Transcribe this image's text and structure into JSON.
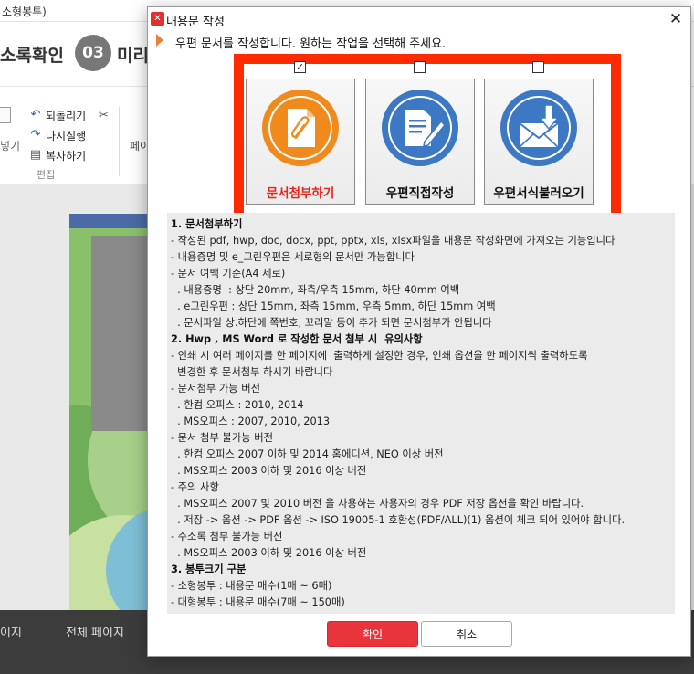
{
  "background": {
    "title": "소형봉투)",
    "step_prev_label": "소록확인",
    "step_number": "03",
    "step_current_label": "미리",
    "ribbon": {
      "paste_label": "넣기",
      "undo_label": "되돌리기",
      "redo_label": "다시실행",
      "copy_label": "복사하기",
      "group_label": "편집",
      "page_label": "페이"
    },
    "bottom_left": "이지",
    "bottom_total": "전체 페이지"
  },
  "dialog": {
    "title": "내용문 작성",
    "instruction": "우편 문서를 작성합니다. 원하는 작업을 선택해 주세요.",
    "options": [
      {
        "label": "문서첨부하기",
        "checked": true,
        "icon": "paperclip-document-icon",
        "color": "#f08a1c"
      },
      {
        "label": "우편직접작성",
        "checked": false,
        "icon": "document-pen-icon",
        "color": "#3d78c4"
      },
      {
        "label": "우편서식불러오기",
        "checked": false,
        "icon": "envelope-download-icon",
        "color": "#3d78c4"
      }
    ],
    "info": [
      {
        "text": "1. 문서첨부하기",
        "h": true
      },
      {
        "text": "- 작성된 pdf, hwp, doc, docx, ppt, pptx, xls, xlsx파일을 내용문 작성화면에 가져오는 기능입니다"
      },
      {
        "text": "- 내용증명 및 e_그린우편은 세로형의 문서만 가능합니다"
      },
      {
        "text": "- 문서 여백 기준(A4 세로)"
      },
      {
        "text": "  . 내용증명  : 상단 20mm, 좌측/우측 15mm, 하단 40mm 여백"
      },
      {
        "text": "  . e그린우편 : 상단 15mm, 좌측 15mm, 우측 5mm, 하단 15mm 여백"
      },
      {
        "text": "  . 문서파일 상.하단에 쪽번호, 꼬리말 등이 추가 되면 문서첨부가 안됩니다"
      },
      {
        "text": "2. Hwp , MS Word 로 작성한 문서 첨부 시  유의사항",
        "h": true
      },
      {
        "text": "- 인쇄 시 여러 페이지를 한 페이지에  출력하게 설정한 경우, 인쇄 옵션을 한 페이지씩 출력하도록"
      },
      {
        "text": "  변경한 후 문서첨부 하시기 바랍니다"
      },
      {
        "text": "- 문서첨부 가능 버전"
      },
      {
        "text": "  . 한컴 오피스 : 2010, 2014"
      },
      {
        "text": "  . MS오피스 : 2007, 2010, 2013"
      },
      {
        "text": "- 문서 첨부 불가능 버전"
      },
      {
        "text": "  . 한컴 오피스 2007 이하 및 2014 홈에디션, NEO 이상 버전"
      },
      {
        "text": "  . MS오피스 2003 이하 및 2016 이상 버전"
      },
      {
        "text": "- 주의 사항"
      },
      {
        "text": "  . MS오피스 2007 및 2010 버전 을 사용하는 사용자의 경우 PDF 저장 옵션을 확인 바랍니다."
      },
      {
        "text": "  . 저장 -> 옵션 -> PDF 옵션 -> ISO 19005-1 호환성(PDF/ALL)(1) 옵션이 체크 되어 있어야 합니다."
      },
      {
        "text": "- 주소록 첨부 불가능 버전"
      },
      {
        "text": "  . MS오피스 2003 이하 및 2016 이상 버전"
      },
      {
        "text": "3. 봉투크기 구분",
        "h": true
      },
      {
        "text": "- 소형봉투 : 내용문 매수(1매 ~ 6매)"
      },
      {
        "text": "- 대형봉투 : 내용문 매수(7매 ~ 150매)"
      }
    ],
    "ok_label": "확인",
    "cancel_label": "취소"
  },
  "colors": {
    "accent_red": "#e8343a",
    "highlight_frame": "#ff2a00",
    "orange": "#f08a1c",
    "blue": "#3d78c4"
  }
}
